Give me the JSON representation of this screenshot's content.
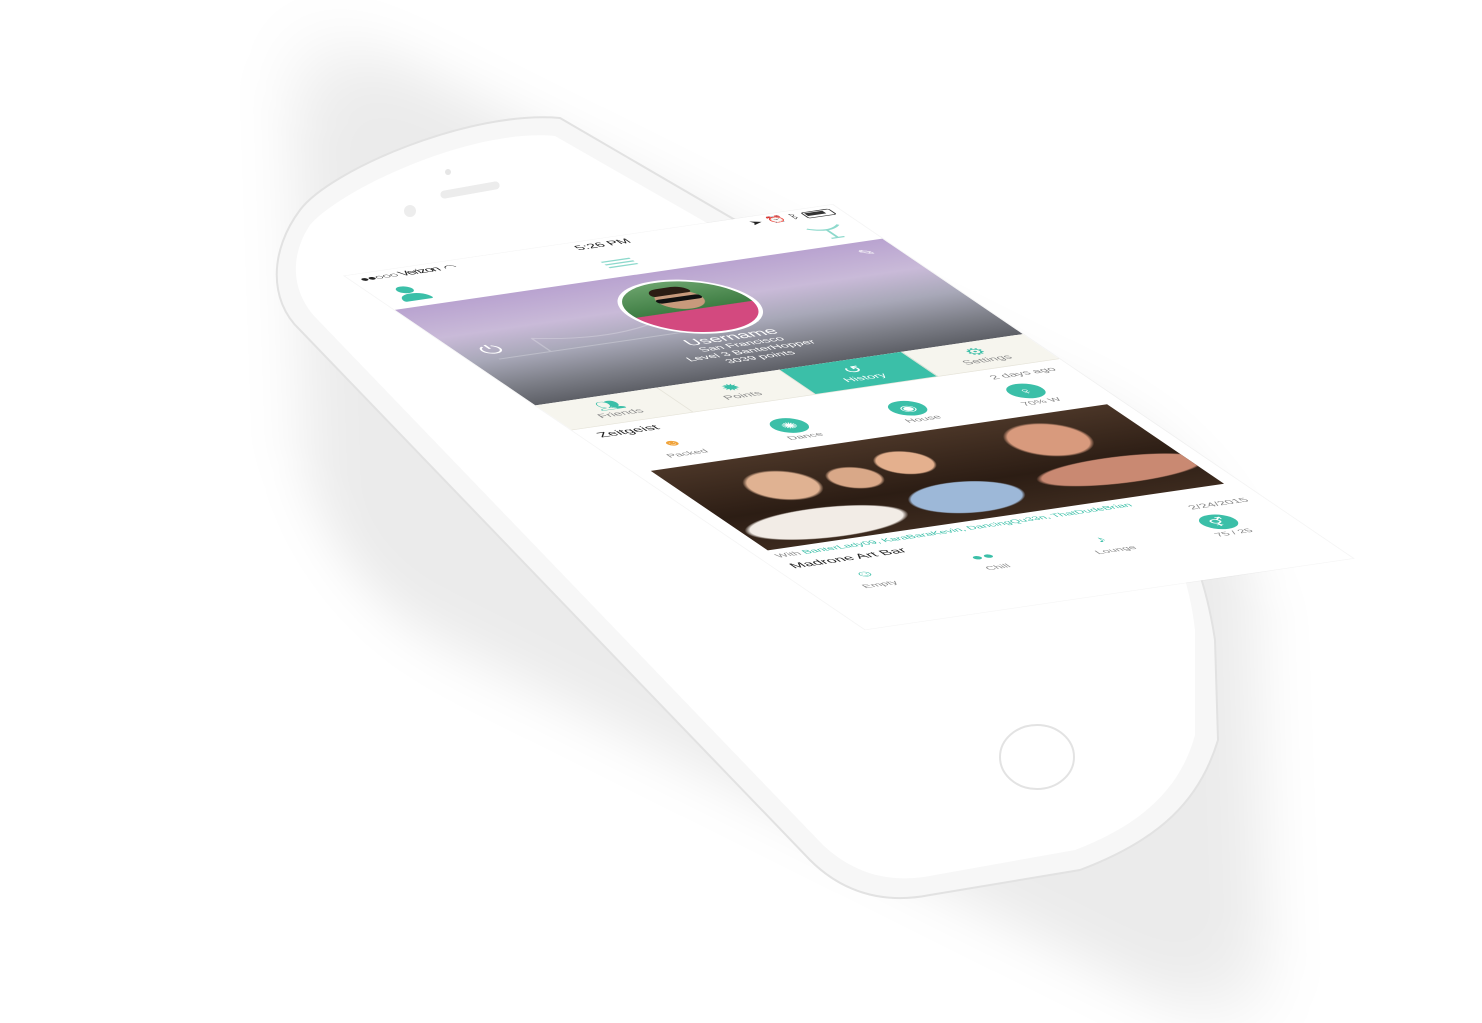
{
  "status_bar": {
    "carrier": "●●○○○ Verizon",
    "time": "5:26 PM"
  },
  "profile": {
    "username": "Username",
    "location": "San Francisco",
    "level": "Level 3 BanterHopper",
    "points": "3039 points"
  },
  "tabs": [
    {
      "label": "Friends",
      "icon": "friends-icon"
    },
    {
      "label": "Points",
      "icon": "points-icon"
    },
    {
      "label": "History",
      "icon": "history-icon",
      "active": true
    },
    {
      "label": "Settings",
      "icon": "settings-icon"
    }
  ],
  "history": [
    {
      "venue": "Zeitgeist",
      "date": "2 days ago",
      "vibes": [
        {
          "label": "Packed",
          "icon": "crowd-icon"
        },
        {
          "label": "Dance",
          "icon": "disco-ball-icon"
        },
        {
          "label": "House",
          "icon": "turntable-icon"
        },
        {
          "label": "70% W",
          "icon": "female-icon"
        }
      ]
    },
    {
      "venue": "Madrone Art Bar",
      "date": "2/24/2015",
      "with_prefix": "With ",
      "with_names": "BanterLady09, KaraBaraKevin, DancingQu33n, ThatDudeBrian",
      "vibes": [
        {
          "label": "Empty",
          "icon": "empty-room-icon"
        },
        {
          "label": "Chill",
          "icon": "sunglasses-icon"
        },
        {
          "label": "Lounge",
          "icon": "saxophone-icon"
        },
        {
          "label": "75 / 25",
          "icon": "gender-ratio-icon"
        }
      ]
    }
  ],
  "colors": {
    "accent": "#3bbfa8",
    "tab_bg": "#f6f5ee"
  }
}
